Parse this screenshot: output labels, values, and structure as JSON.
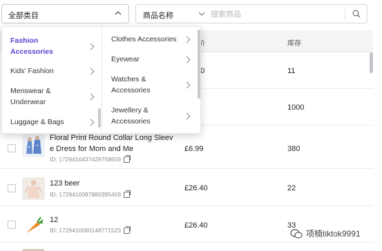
{
  "filters": {
    "category_select": "全部类目",
    "field_select": "商品名称",
    "search_placeholder": "搜索商品"
  },
  "table": {
    "headers": [
      "价",
      "库存"
    ],
    "rows": [
      {
        "name": "",
        "id": "",
        "price": "00",
        "stock": "11"
      },
      {
        "name": "",
        "id": "",
        "price": "1",
        "stock": "1000"
      },
      {
        "name": "Floral Print Round Collar Long Sleeve Dress for Mom and Me",
        "name_line1": "Floral Print Round Collar Long Sleev",
        "name_line2": "e Dress for Mom and Me",
        "id": "ID: 1729410437429758659",
        "price": "£6.99",
        "stock": "380"
      },
      {
        "name": "123 beer",
        "id": "ID: 1729410087880395459",
        "price": "£26.40",
        "stock": "22"
      },
      {
        "name": "12",
        "id": "ID: 1729410060148771523",
        "price": "£26.40",
        "stock": "33"
      }
    ]
  },
  "dropdown": {
    "categories": [
      {
        "line1": "Fashion",
        "line2": "Accessories",
        "active": true
      },
      {
        "line1": "Kids' Fashion",
        "line2": ""
      },
      {
        "line1": "Menswear &",
        "line2": "Underwear"
      },
      {
        "line1": "Luggage & Bags",
        "line2": ""
      }
    ],
    "subcategories": [
      {
        "line1": "Clothes Accessories",
        "line2": ""
      },
      {
        "line1": "Eyewear",
        "line2": ""
      },
      {
        "line1": "Watches &",
        "line2": "Accessories"
      },
      {
        "line1": "Jewellery &",
        "line2": "Accessories"
      }
    ]
  },
  "watermark": "项楠tiktok9991",
  "colors": {
    "accent": "#5b3fd0"
  }
}
